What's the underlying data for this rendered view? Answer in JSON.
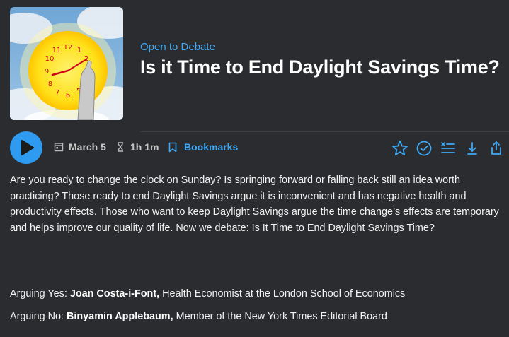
{
  "episode": {
    "show_name": "Open to Debate",
    "title": "Is it Time to End Daylight Savings Time?",
    "date": "March 5",
    "duration": "1h 1m",
    "bookmarks_label": "Bookmarks"
  },
  "icons": {
    "play": "play-icon",
    "calendar": "calendar-icon",
    "hourglass": "hourglass-icon",
    "bookmark": "bookmark-icon",
    "star": "star-icon",
    "check": "check-circle-icon",
    "queue": "add-to-queue-icon",
    "download": "download-icon",
    "share": "share-icon"
  },
  "description": "Are you ready to change the clock on Sunday? Is springing forward or falling back still an idea worth practicing? Those ready to end Daylight Savings argue it is inconvenient and has negative health and productivity effects. Those who want to keep Daylight Savings argue the time change’s effects are temporary and helps improve our quality of life. Now we debate: Is It Time to End Daylight Savings Time?",
  "arguing_yes": {
    "label": "Arguing Yes:",
    "name": "Joan Costa-i-Font,",
    "role": "Health Economist at the London School of Economics"
  },
  "arguing_no": {
    "label": "Arguing No:",
    "name": "Binyamin Applebaum,",
    "role": "Member of the New York Times Editorial Board"
  },
  "colors": {
    "accent": "#3fa9f5",
    "play_button": "#2f9bf0",
    "background": "#2b2c2f"
  }
}
